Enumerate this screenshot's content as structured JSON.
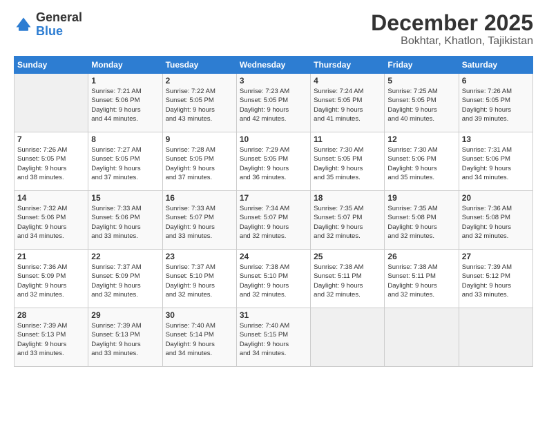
{
  "logo": {
    "general": "General",
    "blue": "Blue"
  },
  "header": {
    "month": "December 2025",
    "location": "Bokhtar, Khatlon, Tajikistan"
  },
  "weekdays": [
    "Sunday",
    "Monday",
    "Tuesday",
    "Wednesday",
    "Thursday",
    "Friday",
    "Saturday"
  ],
  "weeks": [
    [
      {
        "day": "",
        "info": ""
      },
      {
        "day": "1",
        "info": "Sunrise: 7:21 AM\nSunset: 5:06 PM\nDaylight: 9 hours\nand 44 minutes."
      },
      {
        "day": "2",
        "info": "Sunrise: 7:22 AM\nSunset: 5:05 PM\nDaylight: 9 hours\nand 43 minutes."
      },
      {
        "day": "3",
        "info": "Sunrise: 7:23 AM\nSunset: 5:05 PM\nDaylight: 9 hours\nand 42 minutes."
      },
      {
        "day": "4",
        "info": "Sunrise: 7:24 AM\nSunset: 5:05 PM\nDaylight: 9 hours\nand 41 minutes."
      },
      {
        "day": "5",
        "info": "Sunrise: 7:25 AM\nSunset: 5:05 PM\nDaylight: 9 hours\nand 40 minutes."
      },
      {
        "day": "6",
        "info": "Sunrise: 7:26 AM\nSunset: 5:05 PM\nDaylight: 9 hours\nand 39 minutes."
      }
    ],
    [
      {
        "day": "7",
        "info": "Sunrise: 7:26 AM\nSunset: 5:05 PM\nDaylight: 9 hours\nand 38 minutes."
      },
      {
        "day": "8",
        "info": "Sunrise: 7:27 AM\nSunset: 5:05 PM\nDaylight: 9 hours\nand 37 minutes."
      },
      {
        "day": "9",
        "info": "Sunrise: 7:28 AM\nSunset: 5:05 PM\nDaylight: 9 hours\nand 37 minutes."
      },
      {
        "day": "10",
        "info": "Sunrise: 7:29 AM\nSunset: 5:05 PM\nDaylight: 9 hours\nand 36 minutes."
      },
      {
        "day": "11",
        "info": "Sunrise: 7:30 AM\nSunset: 5:05 PM\nDaylight: 9 hours\nand 35 minutes."
      },
      {
        "day": "12",
        "info": "Sunrise: 7:30 AM\nSunset: 5:06 PM\nDaylight: 9 hours\nand 35 minutes."
      },
      {
        "day": "13",
        "info": "Sunrise: 7:31 AM\nSunset: 5:06 PM\nDaylight: 9 hours\nand 34 minutes."
      }
    ],
    [
      {
        "day": "14",
        "info": "Sunrise: 7:32 AM\nSunset: 5:06 PM\nDaylight: 9 hours\nand 34 minutes."
      },
      {
        "day": "15",
        "info": "Sunrise: 7:33 AM\nSunset: 5:06 PM\nDaylight: 9 hours\nand 33 minutes."
      },
      {
        "day": "16",
        "info": "Sunrise: 7:33 AM\nSunset: 5:07 PM\nDaylight: 9 hours\nand 33 minutes."
      },
      {
        "day": "17",
        "info": "Sunrise: 7:34 AM\nSunset: 5:07 PM\nDaylight: 9 hours\nand 32 minutes."
      },
      {
        "day": "18",
        "info": "Sunrise: 7:35 AM\nSunset: 5:07 PM\nDaylight: 9 hours\nand 32 minutes."
      },
      {
        "day": "19",
        "info": "Sunrise: 7:35 AM\nSunset: 5:08 PM\nDaylight: 9 hours\nand 32 minutes."
      },
      {
        "day": "20",
        "info": "Sunrise: 7:36 AM\nSunset: 5:08 PM\nDaylight: 9 hours\nand 32 minutes."
      }
    ],
    [
      {
        "day": "21",
        "info": "Sunrise: 7:36 AM\nSunset: 5:09 PM\nDaylight: 9 hours\nand 32 minutes."
      },
      {
        "day": "22",
        "info": "Sunrise: 7:37 AM\nSunset: 5:09 PM\nDaylight: 9 hours\nand 32 minutes."
      },
      {
        "day": "23",
        "info": "Sunrise: 7:37 AM\nSunset: 5:10 PM\nDaylight: 9 hours\nand 32 minutes."
      },
      {
        "day": "24",
        "info": "Sunrise: 7:38 AM\nSunset: 5:10 PM\nDaylight: 9 hours\nand 32 minutes."
      },
      {
        "day": "25",
        "info": "Sunrise: 7:38 AM\nSunset: 5:11 PM\nDaylight: 9 hours\nand 32 minutes."
      },
      {
        "day": "26",
        "info": "Sunrise: 7:38 AM\nSunset: 5:11 PM\nDaylight: 9 hours\nand 32 minutes."
      },
      {
        "day": "27",
        "info": "Sunrise: 7:39 AM\nSunset: 5:12 PM\nDaylight: 9 hours\nand 33 minutes."
      }
    ],
    [
      {
        "day": "28",
        "info": "Sunrise: 7:39 AM\nSunset: 5:13 PM\nDaylight: 9 hours\nand 33 minutes."
      },
      {
        "day": "29",
        "info": "Sunrise: 7:39 AM\nSunset: 5:13 PM\nDaylight: 9 hours\nand 33 minutes."
      },
      {
        "day": "30",
        "info": "Sunrise: 7:40 AM\nSunset: 5:14 PM\nDaylight: 9 hours\nand 34 minutes."
      },
      {
        "day": "31",
        "info": "Sunrise: 7:40 AM\nSunset: 5:15 PM\nDaylight: 9 hours\nand 34 minutes."
      },
      {
        "day": "",
        "info": ""
      },
      {
        "day": "",
        "info": ""
      },
      {
        "day": "",
        "info": ""
      }
    ]
  ]
}
